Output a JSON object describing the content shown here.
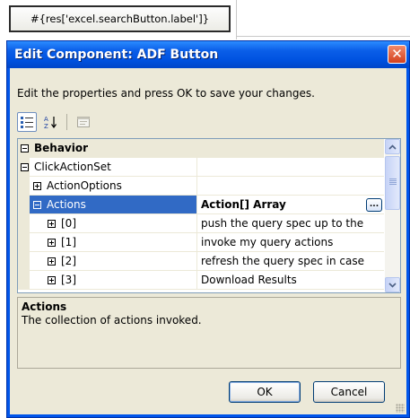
{
  "background": {
    "button_label": "#{res['excel.searchButton.label']}"
  },
  "dialog": {
    "title": "Edit Component: ADF Button",
    "close_glyph": "✕",
    "instructions": "Edit the properties and press OK to save your changes.",
    "toolbar": {
      "categorized": "categorized-view-icon",
      "alphabetical": "sort-az-icon",
      "property_pages": "property-pages-icon"
    },
    "grid": {
      "category": "Behavior",
      "rows": [
        {
          "name": "ClickActionSet",
          "value": ""
        },
        {
          "name": "ActionOptions",
          "value": ""
        },
        {
          "name": "Actions",
          "value": "Action[] Array"
        },
        {
          "name": "[0]",
          "value": "push the query spec up to the"
        },
        {
          "name": "[1]",
          "value": "invoke my query actions"
        },
        {
          "name": "[2]",
          "value": "refresh the query spec in case"
        },
        {
          "name": "[3]",
          "value": "Download Results"
        }
      ],
      "ellipsis": "..."
    },
    "description": {
      "title": "Actions",
      "text": "The collection of actions invoked."
    },
    "ok_label": "OK",
    "cancel_label": "Cancel"
  },
  "colors": {
    "titlebar": "#0a5ee8",
    "selection": "#316ac5",
    "dialog_face": "#ece9d8"
  }
}
